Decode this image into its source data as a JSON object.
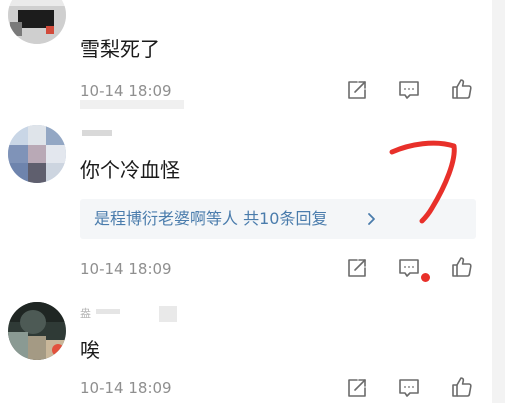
{
  "comments": [
    {
      "text": "雪梨死了",
      "time": "10-14 18:09",
      "username": ""
    },
    {
      "text": "你个冷血怪",
      "time": "10-14 18:09",
      "username": "",
      "replies": {
        "label": "是程博衍老婆啊等人  共10条回复",
        "chevron": "›"
      }
    },
    {
      "text": "唉",
      "time": "10-14 18:09",
      "username": "盎"
    }
  ],
  "icons": {
    "share": "share-icon",
    "comment": "comment-icon",
    "like": "thumbs-up-icon",
    "chevron": "chevron-right-icon"
  },
  "colors": {
    "accent_link": "#4a7cac",
    "notification_dot": "#e8302a",
    "annotation_stroke": "#e8302a",
    "text_primary": "#1a1a1a",
    "text_secondary": "#8f8f8f"
  }
}
